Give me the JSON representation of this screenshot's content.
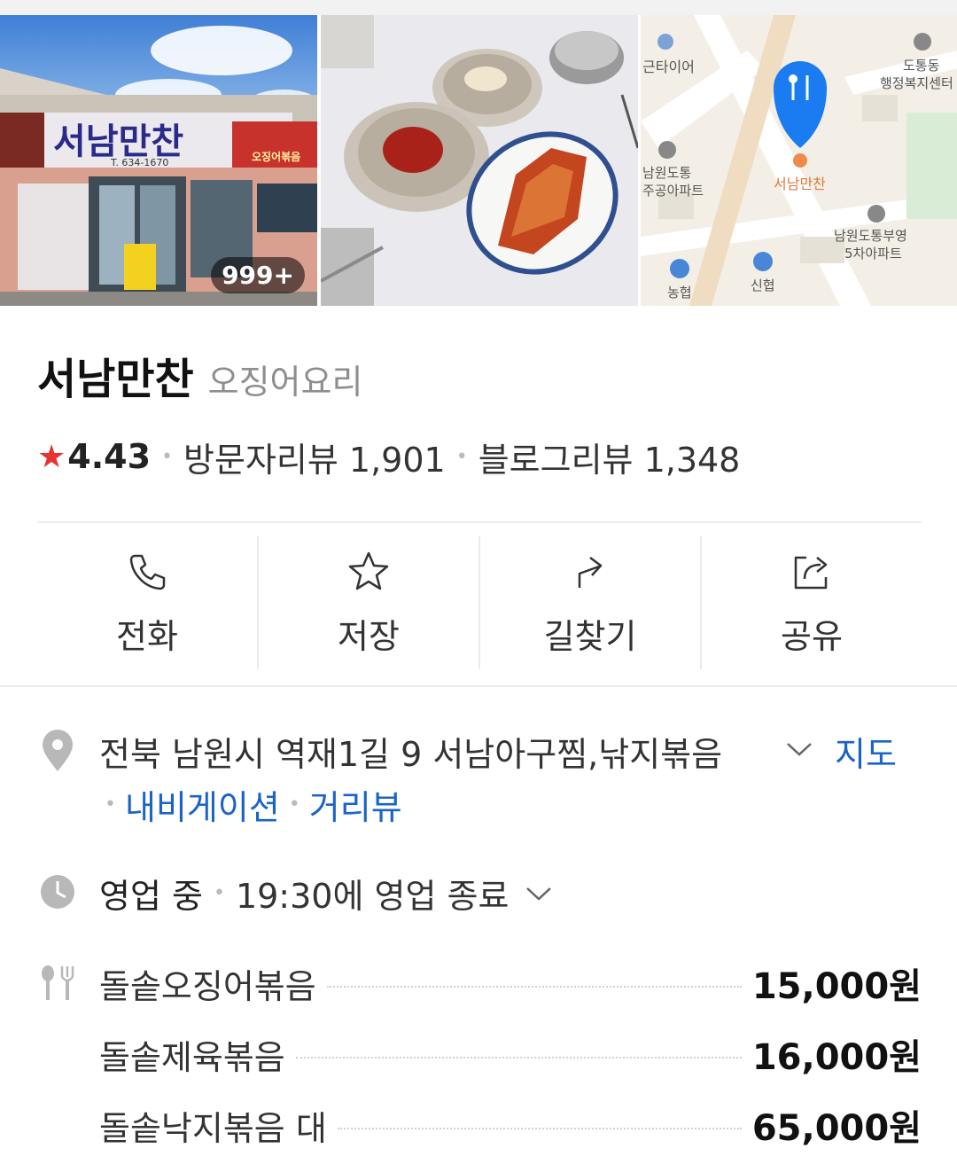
{
  "gallery": {
    "photo_count": "999+",
    "photos": [
      {
        "alt": "restaurant storefront",
        "sign_text": "서남만찬",
        "phone_text": "T. 634-1670",
        "banner_text": "오징어볶음"
      },
      {
        "alt": "side dishes kimchi"
      },
      {
        "alt": "map thumbnail"
      }
    ],
    "map_labels": {
      "place": "서남만찬",
      "tl": "근타이어",
      "tr1": "도통동",
      "tr2": "행정복지센터",
      "ml1": "남원도통",
      "ml2": "주공아파트",
      "mr1": "남원도통부영",
      "mr2": "5차아파트",
      "bl": "농협",
      "bm": "신협"
    }
  },
  "place": {
    "name": "서남만찬",
    "category": "오징어요리",
    "rating": "4.43",
    "visitor_reviews": "방문자리뷰 1,901",
    "blog_reviews": "블로그리뷰 1,348"
  },
  "actions": [
    {
      "label": "전화",
      "icon": "phone-icon"
    },
    {
      "label": "저장",
      "icon": "star-outline-icon"
    },
    {
      "label": "길찾기",
      "icon": "directions-icon"
    },
    {
      "label": "공유",
      "icon": "share-icon"
    }
  ],
  "address": {
    "text": "전북 남원시 역재1길 9 서남아구찜,낚지볶음",
    "map_link": "지도",
    "navigation_link": "내비게이션",
    "streetview_link": "거리뷰"
  },
  "hours": {
    "status": "영업 중",
    "detail": "19:30에 영업 종료"
  },
  "menu": [
    {
      "name": "돌솥오징어볶음",
      "price": "15,000원"
    },
    {
      "name": "돌솥제육볶음",
      "price": "16,000원"
    },
    {
      "name": "돌솥낙지볶음 대",
      "price": "65,000원"
    }
  ],
  "colors": {
    "star": "#e83333",
    "link": "#1a64c8",
    "map_pin": "#1a7cf0"
  }
}
